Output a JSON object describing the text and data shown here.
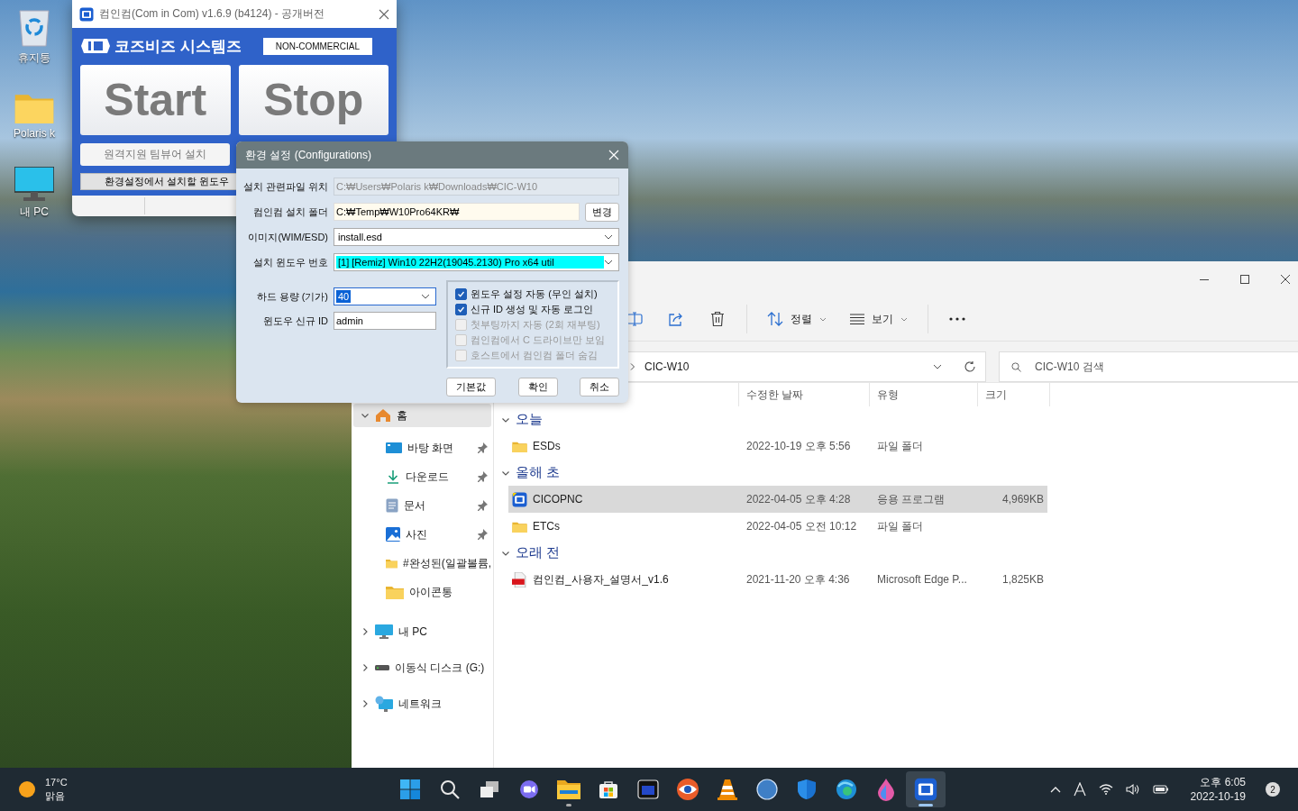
{
  "desktop_icons": [
    {
      "kind": "recycle-bin",
      "label": "휴지통"
    },
    {
      "kind": "folder",
      "label": "Polaris k"
    },
    {
      "kind": "monitor",
      "label": "내 PC"
    }
  ],
  "app_window": {
    "title": "컴인컴(Com in Com) v1.6.9 (b4124) - 공개버전",
    "brand": "코즈비즈 시스템즈",
    "badge": "NON-COMMERCIAL",
    "buttons": [
      "Start",
      "Stop"
    ],
    "teamviewer_button": "원격지원 팀뷰어 설치",
    "status": "환경설정에서 설치할 윈도우"
  },
  "config_dialog": {
    "title": "환경 설정 (Configurations)",
    "rows": [
      {
        "kind": "readonly",
        "label": "설치 관련파일 위치",
        "value": "C:₩Users₩Polaris k₩Downloads₩CIC-W10",
        "highlighted": false
      },
      {
        "kind": "browse",
        "label": "컴인컴 설치 폴더",
        "value": "C:₩Temp₩W10Pro64KR₩",
        "button": "변경",
        "highlighted": false
      },
      {
        "kind": "combo",
        "label": "이미지(WIM/ESD)",
        "value": "install.esd",
        "highlighted": false
      },
      {
        "kind": "combo",
        "label": "설치 윈도우 번호",
        "value": "[1] [Remiz] Win10 22H2(19045.2130) Pro x64 util",
        "highlighted": true
      }
    ],
    "small_rows": [
      {
        "kind": "combo",
        "label": "하드 용량 (기가)",
        "value": "40",
        "highlighted": true
      },
      {
        "kind": "text",
        "label": "윈도우 신규 ID",
        "value": "admin",
        "highlighted": false
      }
    ],
    "options": [
      {
        "label": "윈도우 설정 자동 (무인 설치)",
        "checked": true,
        "disabled": false
      },
      {
        "label": "신규 ID 생성 및 자동 로그인",
        "checked": true,
        "disabled": false
      },
      {
        "label": "첫부팅까지 자동 (2회 재부팅)",
        "checked": false,
        "disabled": true
      },
      {
        "label": "컴인컴에서 C 드라이브만 보임",
        "checked": false,
        "disabled": true
      },
      {
        "label": "호스트에서 컴인컴 폴더 숨김",
        "checked": false,
        "disabled": true
      }
    ],
    "buttons": [
      "기본값",
      "확인",
      "취소"
    ]
  },
  "explorer": {
    "toolbar": [
      {
        "kind": "rename"
      },
      {
        "kind": "share"
      },
      {
        "kind": "delete"
      },
      {
        "kind": "sort",
        "label": "정렬"
      },
      {
        "kind": "view",
        "label": "보기"
      },
      {
        "kind": "more"
      }
    ],
    "address": "CIC-W10",
    "search": {
      "placeholder": "CIC-W10 검색"
    },
    "columns": [
      "수정한 날짜",
      "유형",
      "크기"
    ],
    "nav": [
      {
        "kind": "home",
        "label": "홈",
        "expanded": true,
        "selected": true,
        "children": [
          {
            "kind": "desktop",
            "label": "바탕 화면",
            "pinned": true
          },
          {
            "kind": "download",
            "label": "다운로드",
            "pinned": true
          },
          {
            "kind": "document",
            "label": "문서",
            "pinned": true
          },
          {
            "kind": "picture",
            "label": "사진",
            "pinned": true
          },
          {
            "kind": "folder",
            "label": "#완성된(일괄볼륨,",
            "pinned": false
          },
          {
            "kind": "folder",
            "label": "아이콘통",
            "pinned": false
          }
        ]
      },
      {
        "kind": "pc",
        "label": "내 PC",
        "expanded": false,
        "selected": false
      },
      {
        "kind": "drive",
        "label": "이동식 디스크 (G:)",
        "expanded": false,
        "selected": false
      },
      {
        "kind": "network",
        "label": "네트워크",
        "expanded": false,
        "selected": false
      }
    ],
    "groups": [
      {
        "label": "오늘",
        "expanded": true,
        "files": [
          {
            "kind": "folder",
            "name": "ESDs",
            "modified": "2022-10-19 오후 5:56",
            "type": "파일 폴더",
            "selected": false
          }
        ]
      },
      {
        "label": "올해 초",
        "expanded": true,
        "files": [
          {
            "kind": "app",
            "name": "CICOPNC",
            "modified": "2022-04-05 오후 4:28",
            "type": "응용 프로그램",
            "size": "4,969KB",
            "selected": true
          },
          {
            "kind": "folder",
            "name": "ETCs",
            "modified": "2022-04-05 오전 10:12",
            "type": "파일 폴더",
            "selected": false
          }
        ]
      },
      {
        "label": "오래 전",
        "expanded": true,
        "files": [
          {
            "kind": "pdf",
            "name": "컴인컴_사용자_설명서_v1.6",
            "modified": "2021-11-20 오후 4:36",
            "type": "Microsoft Edge P...",
            "size": "1,825KB",
            "selected": false
          }
        ]
      }
    ]
  },
  "taskbar": {
    "weather": {
      "temp": "17°C",
      "condition": "맑음"
    },
    "apps": [
      {
        "kind": "start",
        "running": false,
        "active": false
      },
      {
        "kind": "search",
        "running": false,
        "active": false
      },
      {
        "kind": "taskview",
        "running": false,
        "active": false
      },
      {
        "kind": "chat",
        "running": false,
        "active": false
      },
      {
        "kind": "explorer",
        "running": true,
        "active": false
      },
      {
        "kind": "store",
        "running": false,
        "active": false
      },
      {
        "kind": "darksquare",
        "running": false,
        "active": false
      },
      {
        "kind": "eye",
        "running": false,
        "active": false
      },
      {
        "kind": "cone",
        "running": false,
        "active": false
      },
      {
        "kind": "bluecircle",
        "running": false,
        "active": false
      },
      {
        "kind": "shield",
        "running": false,
        "active": false
      },
      {
        "kind": "edge",
        "running": false,
        "active": false
      },
      {
        "kind": "drop",
        "running": false,
        "active": false
      },
      {
        "kind": "cic",
        "running": true,
        "active": true
      }
    ],
    "clock": {
      "time": "오후 6:05",
      "date": "2022-10-19"
    },
    "notifications": "2"
  }
}
